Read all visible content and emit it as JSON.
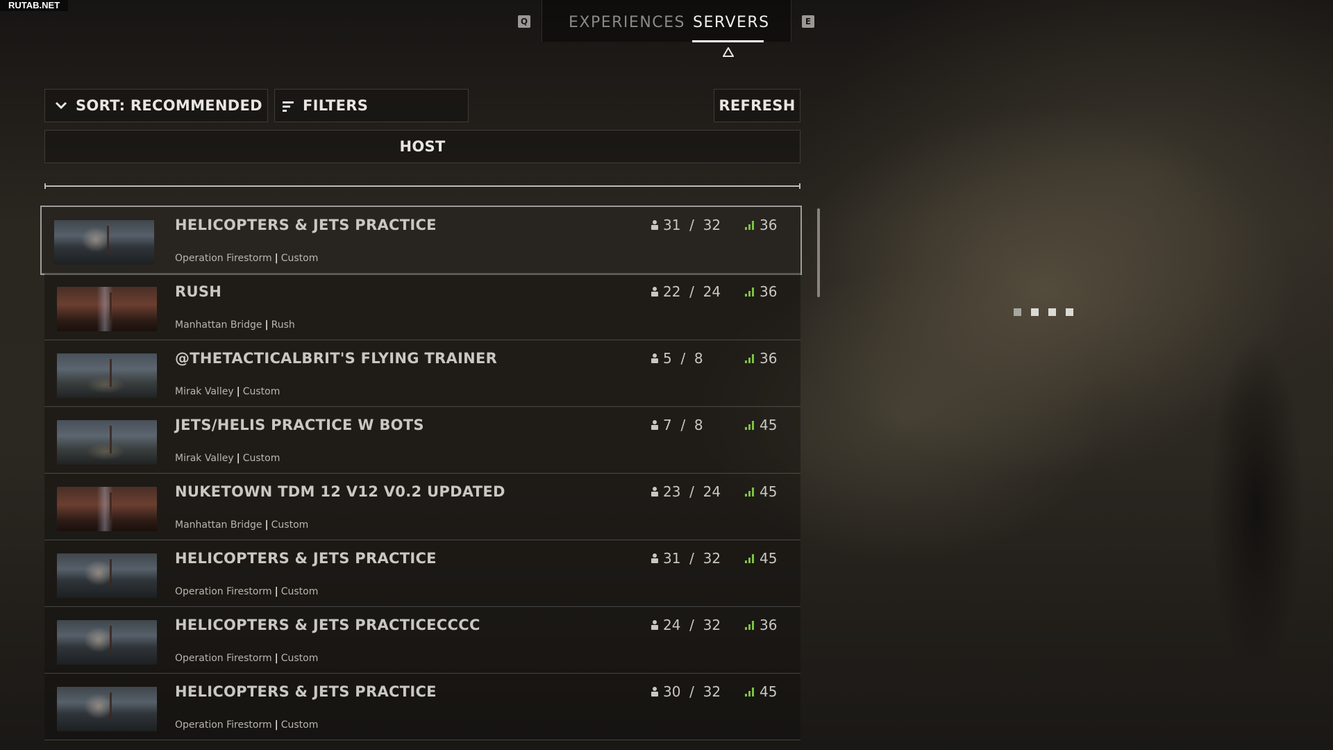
{
  "watermark": "RUTAB.NET",
  "tabs": {
    "left_key": "Q",
    "right_key": "E",
    "items": [
      {
        "label": "EXPERIENCES",
        "active": false
      },
      {
        "label": "SERVERS",
        "active": true
      }
    ]
  },
  "controls": {
    "sort_label": "SORT: RECOMMENDED",
    "filters_label": "FILTERS",
    "refresh_label": "REFRESH",
    "host_label": "HOST"
  },
  "servers": [
    {
      "name": "HELICOPTERS & JETS PRACTICE",
      "map": "Operation Firestorm",
      "mode": "Custom",
      "players": "31",
      "max": "32",
      "ping": "36",
      "thumb": "firestorm",
      "selected": true
    },
    {
      "name": "RUSH",
      "map": "Manhattan Bridge",
      "mode": "Rush",
      "players": "22",
      "max": "24",
      "ping": "36",
      "thumb": "manhattan",
      "selected": false
    },
    {
      "name": "@THETACTICALBRIT'S FLYING TRAINER",
      "map": "Mirak Valley",
      "mode": "Custom",
      "players": "5",
      "max": "8",
      "ping": "36",
      "thumb": "mirak",
      "selected": false
    },
    {
      "name": "JETS/HELIS PRACTICE W BOTS",
      "map": "Mirak Valley",
      "mode": "Custom",
      "players": "7",
      "max": "8",
      "ping": "45",
      "thumb": "mirak",
      "selected": false
    },
    {
      "name": "NUKETOWN TDM 12 V12 V0.2 UPDATED",
      "map": "Manhattan Bridge",
      "mode": "Custom",
      "players": "23",
      "max": "24",
      "ping": "45",
      "thumb": "manhattan",
      "selected": false
    },
    {
      "name": "HELICOPTERS & JETS PRACTICE",
      "map": "Operation Firestorm",
      "mode": "Custom",
      "players": "31",
      "max": "32",
      "ping": "45",
      "thumb": "firestorm",
      "selected": false
    },
    {
      "name": "HELICOPTERS & JETS PRACTICECCCC",
      "map": "Operation Firestorm",
      "mode": "Custom",
      "players": "24",
      "max": "32",
      "ping": "36",
      "thumb": "firestorm",
      "selected": false
    },
    {
      "name": "HELICOPTERS & JETS PRACTICE",
      "map": "Operation Firestorm",
      "mode": "Custom",
      "players": "30",
      "max": "32",
      "ping": "45",
      "thumb": "firestorm",
      "selected": false
    }
  ],
  "icons": {
    "player": "player-icon",
    "ping": "signal-icon",
    "sort": "chevron-down-icon",
    "filter": "filter-icon"
  },
  "colors": {
    "ping_green": "#7dc242",
    "accent_white": "#ffffff"
  }
}
